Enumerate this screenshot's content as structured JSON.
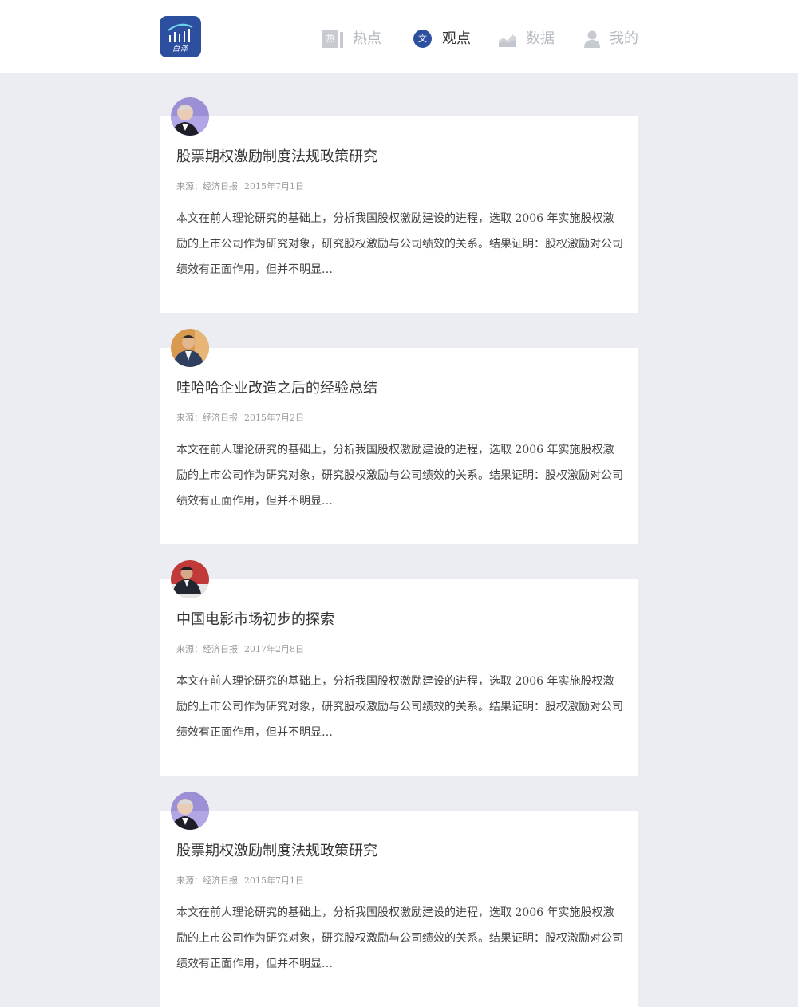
{
  "logo": {
    "text": "白泽",
    "accent": "#2d4fa0"
  },
  "nav": [
    {
      "label": "热点",
      "icon": "hot-icon",
      "icon_char": "热",
      "active": false
    },
    {
      "label": "观点",
      "icon": "opinion-icon",
      "icon_char": "文",
      "active": true
    },
    {
      "label": "数据",
      "icon": "data-chart-icon",
      "active": false
    },
    {
      "label": "我的",
      "icon": "user-icon",
      "active": false
    }
  ],
  "articles": [
    {
      "title": "股票期权激励制度法规政策研究",
      "source": "来源：经济日报",
      "date": "2015年7月1日",
      "summary": "本文在前人理论研究的基础上，分析我国股权激励建设的进程，选取 2006 年实施股权激励的上市公司作为研究对象，研究股权激励与公司绩效的关系。结果证明：股权激励对公司绩效有正面作用，但并不明显…",
      "avatar": "author-avatar"
    },
    {
      "title": "哇哈哈企业改造之后的经验总结",
      "source": "来源：经济日报",
      "date": "2015年7月2日",
      "summary": "本文在前人理论研究的基础上，分析我国股权激励建设的进程，选取 2006 年实施股权激励的上市公司作为研究对象，研究股权激励与公司绩效的关系。结果证明：股权激励对公司绩效有正面作用，但并不明显…",
      "avatar": "author-avatar"
    },
    {
      "title": "中国电影市场初步的探索",
      "source": "来源：经济日报",
      "date": "2017年2月8日",
      "summary": "本文在前人理论研究的基础上，分析我国股权激励建设的进程，选取 2006 年实施股权激励的上市公司作为研究对象，研究股权激励与公司绩效的关系。结果证明：股权激励对公司绩效有正面作用，但并不明显…",
      "avatar": "author-avatar"
    },
    {
      "title": "股票期权激励制度法规政策研究",
      "source": "来源：经济日报",
      "date": "2015年7月1日",
      "summary": "本文在前人理论研究的基础上，分析我国股权激励建设的进程，选取 2006 年实施股权激励的上市公司作为研究对象，研究股权激励与公司绩效的关系。结果证明：股权激励对公司绩效有正面作用，但并不明显…",
      "avatar": "author-avatar"
    }
  ]
}
